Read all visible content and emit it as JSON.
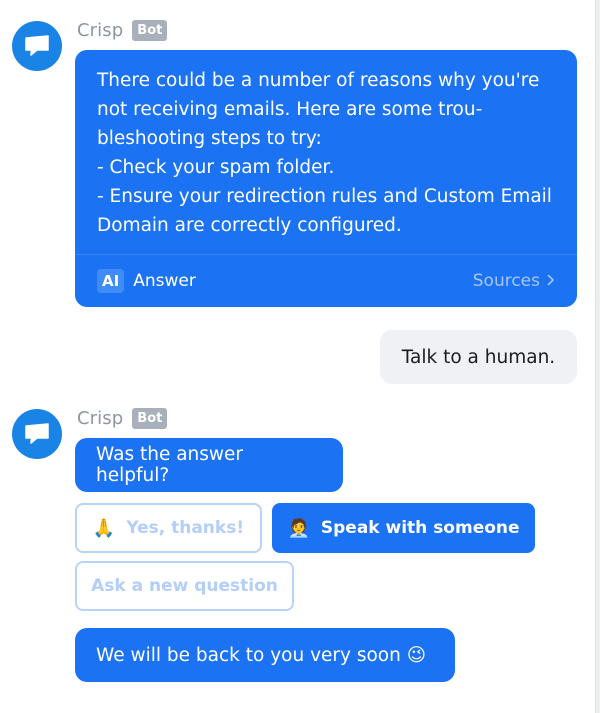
{
  "first_message": {
    "sender": "Crisp",
    "badge": "Bot",
    "text": "There could be a number of reasons why you're\nnot receiving emails. Here are some trou-\nbleshooting steps to try:\n- Check your spam folder.\n- Ensure your redirection rules and Custom Email\nDomain are correctly configured.",
    "footer": {
      "ai_badge": "AI",
      "label": "Answer",
      "sources": "Sources",
      "sources_icon": "chevron-right-icon"
    }
  },
  "user_message": {
    "text": "Talk to a human."
  },
  "second_message": {
    "sender": "Crisp",
    "badge": "Bot",
    "question": "Was the answer helpful?",
    "quick_replies": [
      {
        "emoji": "🙏",
        "label": "Yes, thanks!",
        "state": "disabled"
      },
      {
        "emoji": "🧑‍💼",
        "label": "Speak with someone",
        "state": "selected"
      },
      {
        "label": "Ask a new question",
        "state": "disabled"
      }
    ],
    "followup": "We will be back to you very soon 😉"
  },
  "colors": {
    "operator_bubble": "#1b72f2",
    "avatar": "#1a84e6",
    "user_bubble": "#f0f1f4",
    "bot_badge": "#a7b0bb",
    "quick_reply_border": "#b8d3f8"
  },
  "icons": {
    "avatar": "chat-bubble-icon"
  }
}
